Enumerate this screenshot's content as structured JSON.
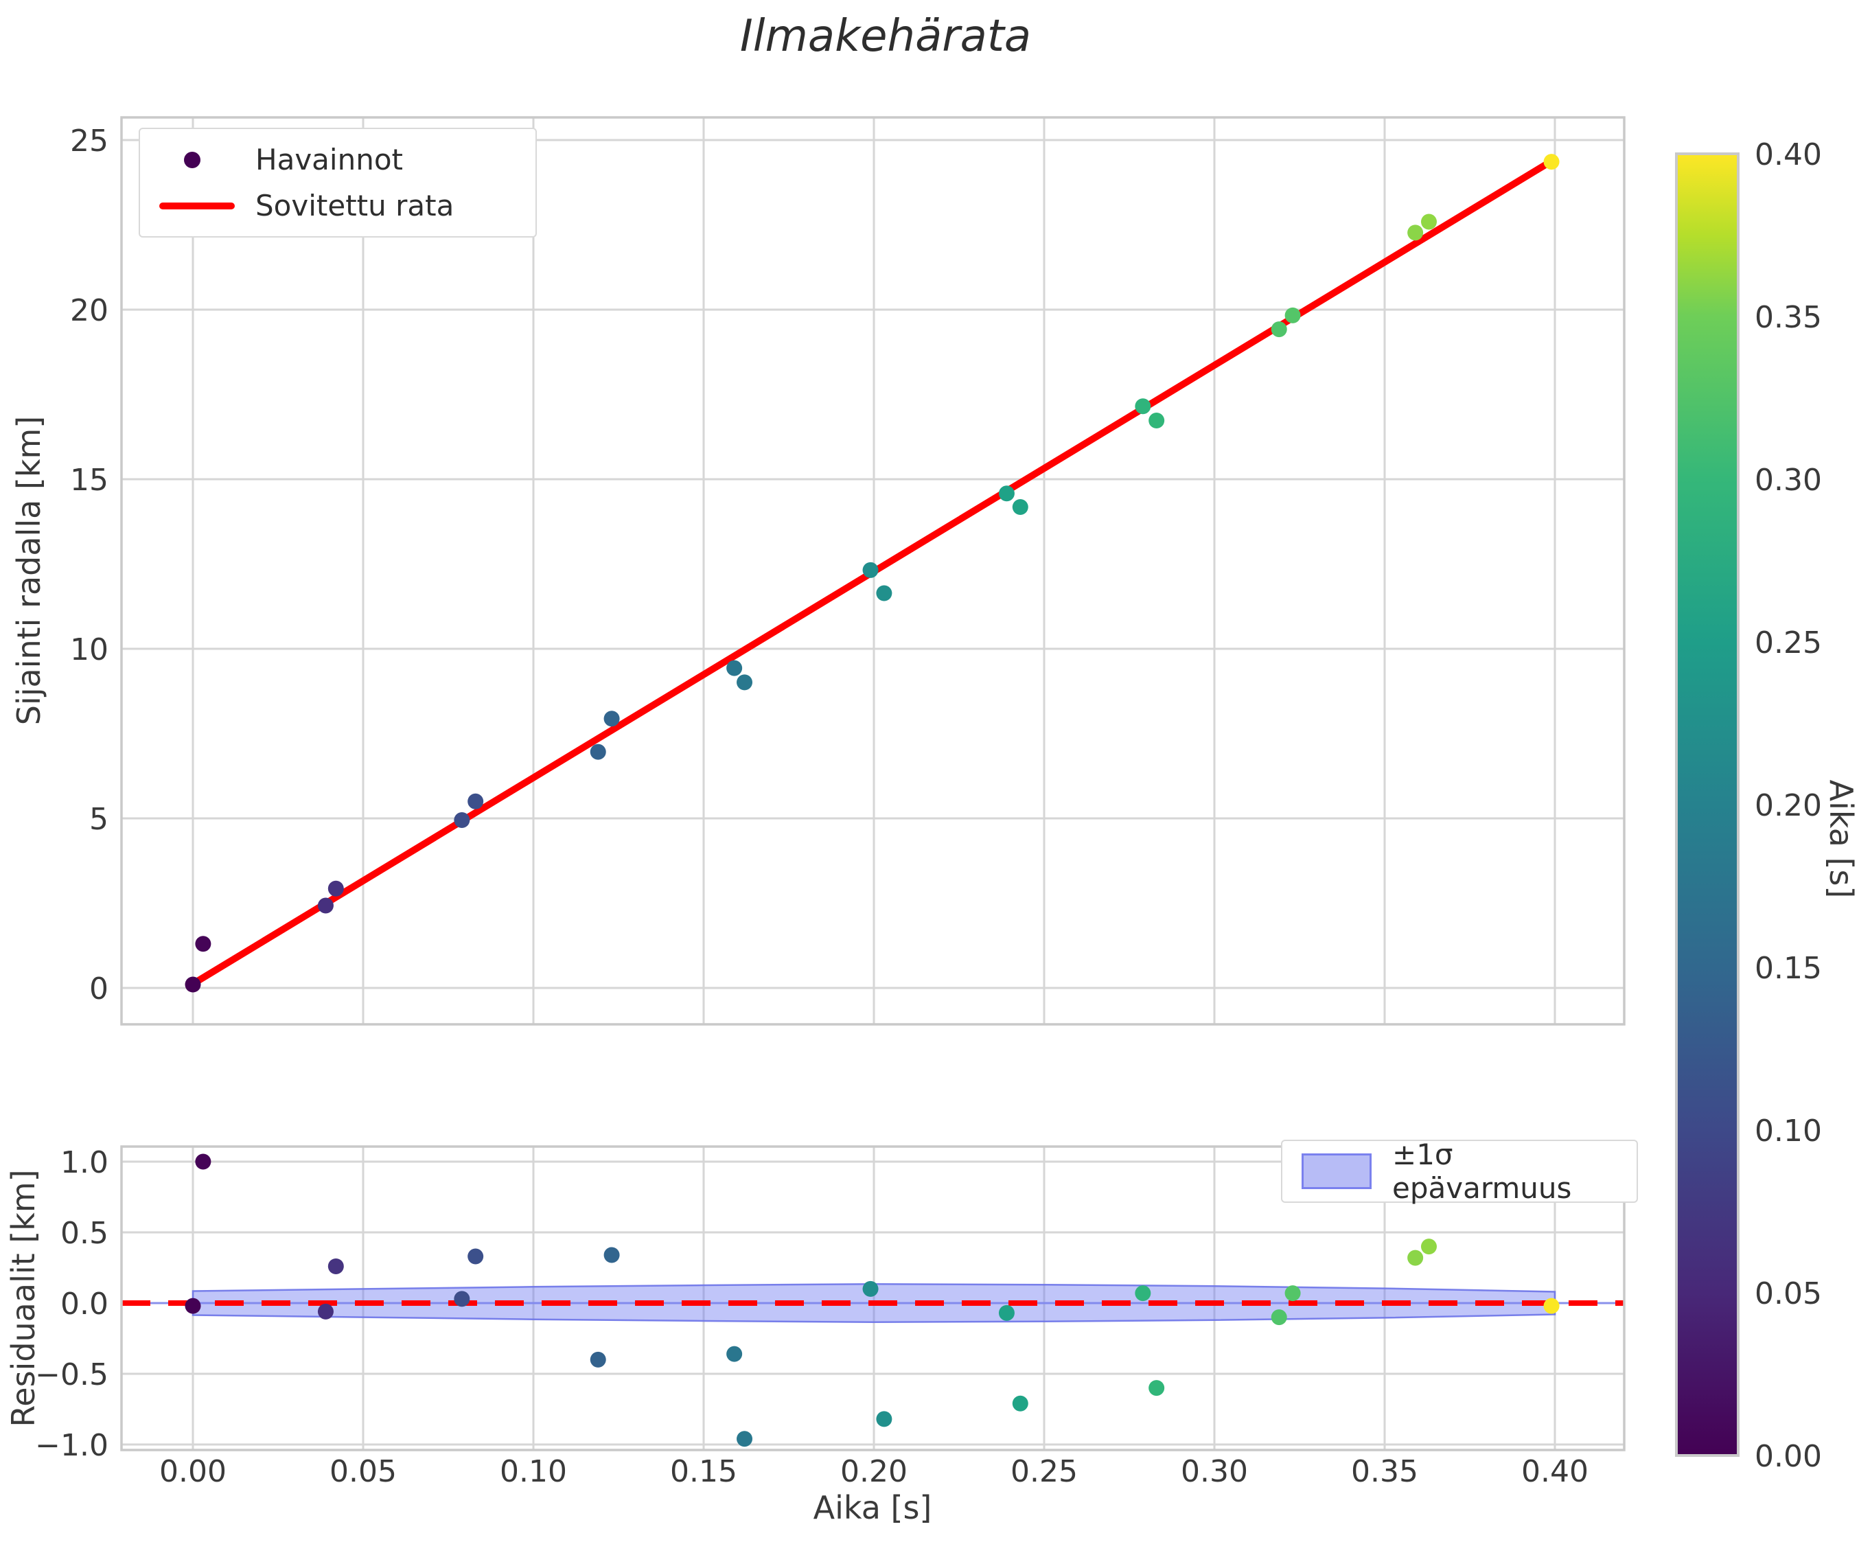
{
  "title": "Ilmakehärata",
  "main_plot": {
    "ylabel": "Sijainti radalla [km]",
    "legend": {
      "scatter_label": "Havainnot",
      "line_label": "Sovitettu rata"
    },
    "ytick_labels": [
      "0",
      "5",
      "10",
      "15",
      "20",
      "25"
    ]
  },
  "residual_plot": {
    "ylabel": "Residuaalit [km]",
    "xlabel": "Aika [s]",
    "legend": {
      "band_label": "±1σ epävarmuus"
    },
    "ytick_labels": [
      "1.0",
      "0.5",
      "0.0",
      "−0.5",
      "−1.0"
    ]
  },
  "colorbar": {
    "label": "Aika [s]",
    "tick_labels": [
      "0.40",
      "0.35",
      "0.30",
      "0.25",
      "0.20",
      "0.15",
      "0.10",
      "0.05",
      "0.00"
    ]
  },
  "colors": {
    "fit_line": "#ff0000",
    "zero_line": "#7b84ee",
    "band_fill": "#6a74f0",
    "band_edge": "#6b73e8",
    "grid": "#d6d6d6",
    "spine": "#c9c9c9",
    "text": "#3a3a3a",
    "legend_marker": "#440154"
  },
  "chart_data": {
    "type": "scatter",
    "title": "Ilmakehärata",
    "xlabel": "Aika [s]",
    "ylabel_main": "Sijainti radalla [km]",
    "ylabel_residual": "Residuaalit [km]",
    "xlim": [
      -0.021,
      0.4204
    ],
    "ylim_main": [
      -1.07,
      25.66
    ],
    "ylim_residual": [
      -1.13,
      1.11
    ],
    "xtick_values": [
      0.0,
      0.05,
      0.1,
      0.15,
      0.2,
      0.25,
      0.3,
      0.35,
      0.4
    ],
    "xtick_labels": [
      "0.00",
      "0.05",
      "0.10",
      "0.15",
      "0.20",
      "0.25",
      "0.30",
      "0.35",
      "0.40"
    ],
    "ytick_values_main": [
      0,
      5,
      10,
      15,
      20,
      25
    ],
    "ytick_values_residual": [
      1.0,
      0.5,
      0.0,
      -0.5,
      -1.0
    ],
    "grid": true,
    "legend_position_main": "upper-left",
    "legend_position_residual": "upper-right",
    "points": [
      {
        "t": 0.0,
        "y": 0.1,
        "resid": -0.02,
        "color": "#440154"
      },
      {
        "t": 0.003,
        "y": 1.3,
        "resid": 1.0,
        "color": "#450457"
      },
      {
        "t": 0.039,
        "y": 2.43,
        "resid": -0.06,
        "color": "#46307e"
      },
      {
        "t": 0.042,
        "y": 2.93,
        "resid": 0.26,
        "color": "#463480"
      },
      {
        "t": 0.079,
        "y": 4.95,
        "resid": 0.03,
        "color": "#3d4e8a"
      },
      {
        "t": 0.083,
        "y": 5.5,
        "resid": 0.33,
        "color": "#3c508b"
      },
      {
        "t": 0.119,
        "y": 6.96,
        "resid": -0.4,
        "color": "#33628d"
      },
      {
        "t": 0.123,
        "y": 7.94,
        "resid": 0.34,
        "color": "#32658e"
      },
      {
        "t": 0.159,
        "y": 9.43,
        "resid": -0.36,
        "color": "#2a768e"
      },
      {
        "t": 0.162,
        "y": 9.01,
        "resid": -0.96,
        "color": "#29788e"
      },
      {
        "t": 0.199,
        "y": 12.32,
        "resid": 0.1,
        "color": "#218e8d"
      },
      {
        "t": 0.203,
        "y": 11.64,
        "resid": -0.82,
        "color": "#21908c"
      },
      {
        "t": 0.239,
        "y": 14.58,
        "resid": -0.07,
        "color": "#1fa287"
      },
      {
        "t": 0.243,
        "y": 14.18,
        "resid": -0.71,
        "color": "#20a486"
      },
      {
        "t": 0.279,
        "y": 17.15,
        "resid": 0.07,
        "color": "#2fb47c"
      },
      {
        "t": 0.283,
        "y": 16.73,
        "resid": -0.6,
        "color": "#31b679"
      },
      {
        "t": 0.319,
        "y": 19.42,
        "resid": -0.1,
        "color": "#50c46a"
      },
      {
        "t": 0.323,
        "y": 19.83,
        "resid": 0.07,
        "color": "#54c568"
      },
      {
        "t": 0.359,
        "y": 22.27,
        "resid": 0.32,
        "color": "#8bd548"
      },
      {
        "t": 0.363,
        "y": 22.59,
        "resid": 0.4,
        "color": "#90d743"
      },
      {
        "t": 0.399,
        "y": 24.36,
        "resid": -0.02,
        "color": "#fbe723"
      }
    ],
    "fit": {
      "label": "Sovitettu rata",
      "slope": 60.8,
      "intercept": 0.12,
      "t_start": -0.001,
      "t_end": 0.3995,
      "color": "#ff0000"
    },
    "band": {
      "label": "±1σ epävarmuus",
      "halfwidths": [
        {
          "t": 0.0,
          "w": 0.085
        },
        {
          "t": 0.05,
          "w": 0.1
        },
        {
          "t": 0.1,
          "w": 0.115
        },
        {
          "t": 0.15,
          "w": 0.126
        },
        {
          "t": 0.2,
          "w": 0.135
        },
        {
          "t": 0.25,
          "w": 0.13
        },
        {
          "t": 0.3,
          "w": 0.12
        },
        {
          "t": 0.35,
          "w": 0.104
        },
        {
          "t": 0.4,
          "w": 0.08
        }
      ]
    },
    "colorbar": {
      "label": "Aika [s]",
      "min": 0.0,
      "max": 0.4,
      "colormap": "viridis",
      "tick_labels": [
        "0.40",
        "0.35",
        "0.30",
        "0.25",
        "0.20",
        "0.15",
        "0.10",
        "0.05",
        "0.00"
      ]
    }
  }
}
